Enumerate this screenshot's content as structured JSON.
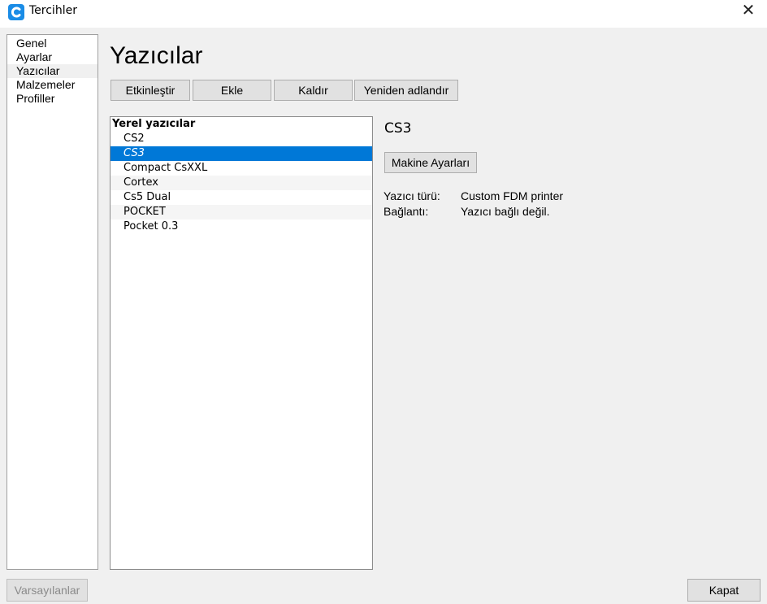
{
  "window": {
    "title": "Tercihler",
    "close_glyph": "✕",
    "app_icon": "cura-icon",
    "app_icon_color": "#1a8ce6"
  },
  "sidebar": {
    "items": [
      {
        "label": "Genel",
        "active": false
      },
      {
        "label": "Ayarlar",
        "active": false
      },
      {
        "label": "Yazıcılar",
        "active": true
      },
      {
        "label": "Malzemeler",
        "active": false
      },
      {
        "label": "Profiller",
        "active": false
      }
    ]
  },
  "page": {
    "title": "Yazıcılar"
  },
  "toolbar": {
    "activate": "Etkinleştir",
    "add": "Ekle",
    "remove": "Kaldır",
    "rename": "Yeniden adlandır"
  },
  "printer_list": {
    "header": "Yerel yazıcılar",
    "selected": "CS3",
    "items": [
      "CS2",
      "CS3",
      "Compact CsXXL",
      "Cortex",
      "Cs5 Dual",
      "POCKET",
      "Pocket 0.3"
    ]
  },
  "detail": {
    "title": "CS3",
    "machine_settings": "Makine Ayarları",
    "type_label": "Yazıcı türü:",
    "type_value": "Custom FDM printer",
    "conn_label": "Bağlantı:",
    "conn_value": "Yazıcı bağlı değil."
  },
  "footer": {
    "defaults": "Varsayılanlar",
    "close": "Kapat"
  },
  "colors": {
    "selection": "#0078d7",
    "background": "#f0f0f0"
  }
}
